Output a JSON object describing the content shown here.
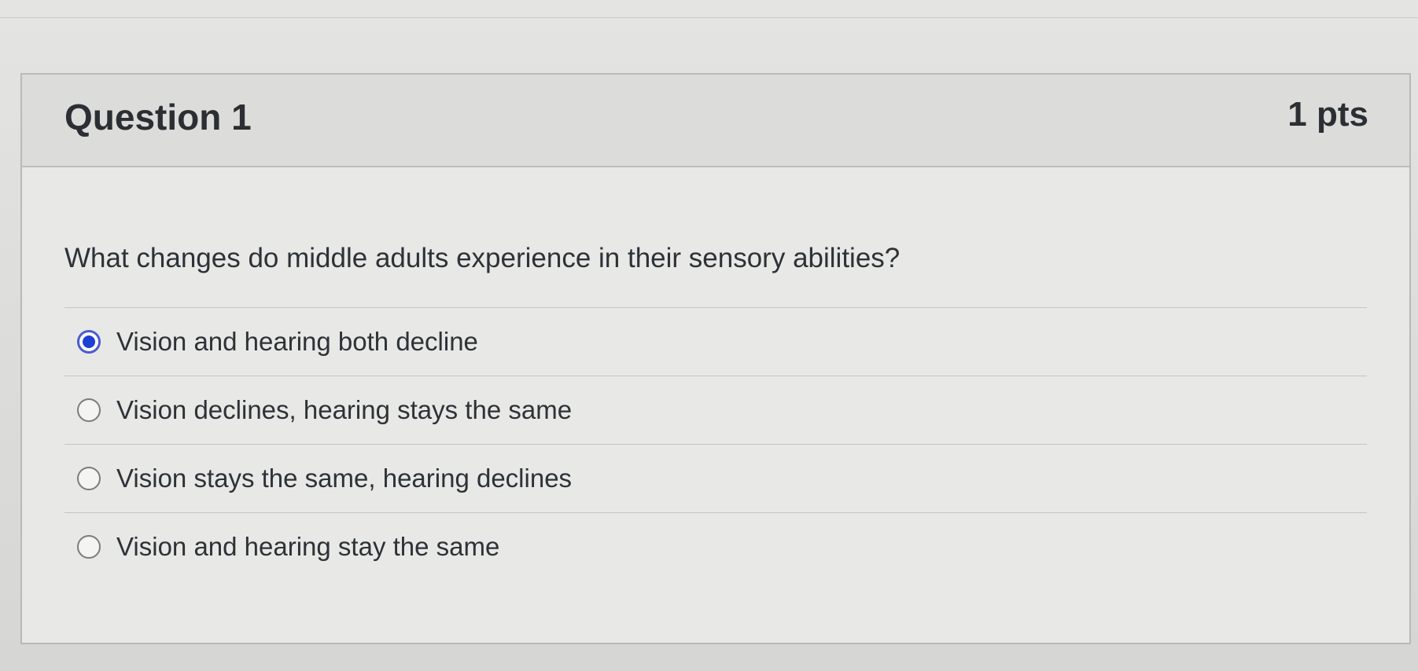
{
  "question": {
    "title": "Question 1",
    "points": "1 pts",
    "text": "What changes do middle adults experience in their sensory abilities?",
    "answers": [
      {
        "label": "Vision and hearing both decline",
        "selected": true
      },
      {
        "label": "Vision declines, hearing stays the same",
        "selected": false
      },
      {
        "label": "Vision stays the same, hearing declines",
        "selected": false
      },
      {
        "label": "Vision and hearing stay the same",
        "selected": false
      }
    ]
  },
  "colors": {
    "selected_radio": "#1d3fd6",
    "header_background": "#dcdcda",
    "text": "#2d3237"
  }
}
